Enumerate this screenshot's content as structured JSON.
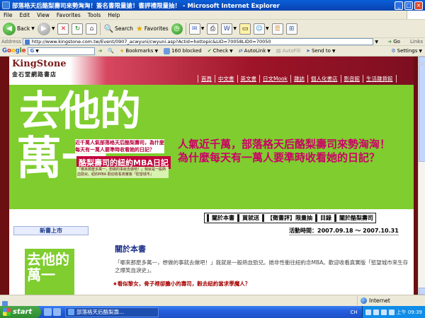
{
  "window": {
    "title": "部落格天后酪梨壽司來勢洶洶！簽名書限量搶！書評禮限量抽！ - Microsoft Internet Explorer",
    "buttons": {
      "minimize": "_",
      "maximize": "□",
      "close": "×"
    }
  },
  "menu": [
    "File",
    "Edit",
    "View",
    "Favorites",
    "Tools",
    "Help"
  ],
  "toolbar": {
    "back": "Back",
    "search": "Search",
    "favorites": "Favorites"
  },
  "address": {
    "label": "Address",
    "url": "http://www.kingstone.com.tw/Event/0907_acwyuni/cwyuni.asp?Actid=hottopic&LID=70058LID0=70050",
    "go": "Go",
    "links": "Links"
  },
  "google": {
    "logo": "Google",
    "search_value": "G",
    "bookmarks": "Bookmarks",
    "blocked": "160 blocked",
    "check": "Check",
    "autolink": "AutoLink",
    "autofill": "AutoFill",
    "sendto": "Send to",
    "settings": "Settings"
  },
  "site": {
    "logo_en": "KingStone",
    "logo_zh": "金石堂網路書店",
    "nav": [
      "首頁",
      "中文書",
      "英文書",
      "日文Mook",
      "雜誌",
      "個人化書店",
      "影音館",
      "生活雜貨館"
    ]
  },
  "banner": {
    "big_line1": "去他的",
    "big_line2": "萬一",
    "sub1": "近千萬人氣部落格天后酪梨壽司，為什麼每天有一萬人要準時收看她的日記？",
    "sub2": "酪梨壽司的紐約MBA日記",
    "sub3": "「哪來那麼多萬一，想做的事就去做吧！」我就是一般熱血勁兒。紐約MBA 歡迎收看真實版「慾望城市」",
    "slogan_line1": "人氣近千萬，部落格天后酪梨壽司來勢洶洶！",
    "slogan_line2": "為什麼每天有一萬人要準時收看她的日記？",
    "links": [
      "關於本書",
      "買就送",
      "【徵書評】限量抽",
      "目錄",
      "關於酪梨壽司"
    ]
  },
  "sidebar": {
    "title": "新書上市",
    "book_title": "去他的萬一"
  },
  "main": {
    "period": "活動時間：2007.09.18 ～ 2007.10.31",
    "heading": "關於本書",
    "paragraph": "「哪來那麼多萬一，想做的事就去做吧！」我就是一般熱血勁兒。她非性衝往紐約念MBA。歡迎收看真實版「慾望城市來生存之爆笑血淚史」。",
    "bullet": "★看似黎女，骨子裡卻膽小的壽司，穀去紐約當求學魔人？"
  },
  "status": {
    "zone": "Internet"
  },
  "taskbar": {
    "start": "start",
    "task": "部落格天后酪梨壽...",
    "lang": "CH",
    "time": "上午 09:39"
  }
}
